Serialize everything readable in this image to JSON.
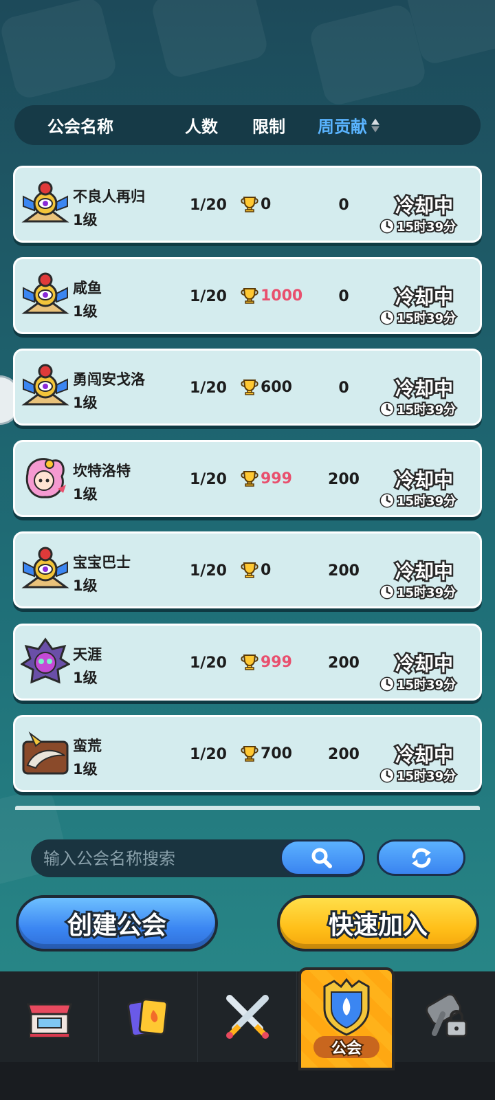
{
  "header": {
    "col_name": "公会名称",
    "col_members": "人数",
    "col_limit": "限制",
    "col_weekly": "周贡献"
  },
  "guilds": [
    {
      "name": "不良人再归",
      "level": "1级",
      "members": "1/20",
      "limit": "0",
      "limit_color": "#1c1c1c",
      "weekly": "0",
      "status": "冷却中",
      "cooldown": "15时39分",
      "emblem": "eye-pyramid-emblem"
    },
    {
      "name": "咸鱼",
      "level": "1级",
      "members": "1/20",
      "limit": "1000",
      "limit_color": "#e8506e",
      "weekly": "0",
      "status": "冷却中",
      "cooldown": "15时39分",
      "emblem": "eye-pyramid-emblem"
    },
    {
      "name": "勇闯安戈洛",
      "level": "1级",
      "members": "1/20",
      "limit": "600",
      "limit_color": "#1c1c1c",
      "weekly": "0",
      "status": "冷却中",
      "cooldown": "15时39分",
      "emblem": "eye-pyramid-emblem"
    },
    {
      "name": "坎特洛特",
      "level": "1级",
      "members": "1/20",
      "limit": "999",
      "limit_color": "#e8506e",
      "weekly": "200",
      "status": "冷却中",
      "cooldown": "15时39分",
      "emblem": "pink-fairy-emblem"
    },
    {
      "name": "宝宝巴士",
      "level": "1级",
      "members": "1/20",
      "limit": "0",
      "limit_color": "#1c1c1c",
      "weekly": "200",
      "status": "冷却中",
      "cooldown": "15时39分",
      "emblem": "eye-pyramid-emblem"
    },
    {
      "name": "天涯",
      "level": "1级",
      "members": "1/20",
      "limit": "999",
      "limit_color": "#e8506e",
      "weekly": "200",
      "status": "冷却中",
      "cooldown": "15时39分",
      "emblem": "purple-demon-emblem"
    },
    {
      "name": "蛮荒",
      "level": "1级",
      "members": "1/20",
      "limit": "700",
      "limit_color": "#1c1c1c",
      "weekly": "200",
      "status": "冷却中",
      "cooldown": "15时39分",
      "emblem": "horn-emblem"
    }
  ],
  "search": {
    "placeholder": "输入公会名称搜索",
    "icon": "search-icon",
    "refresh_icon": "refresh-icon"
  },
  "actions": {
    "create_label": "创建公会",
    "join_label": "快速加入"
  },
  "nav": {
    "items": [
      {
        "icon": "shop-icon"
      },
      {
        "icon": "cards-icon"
      },
      {
        "icon": "battle-swords-icon"
      },
      {
        "icon": "guild-shield-icon",
        "label": "公会",
        "active": true
      },
      {
        "icon": "locked-hammer-icon"
      }
    ],
    "guild_label": "公会"
  },
  "colors": {
    "accent_blue": "#5ab4ff",
    "highlight_pink": "#e8506e",
    "button_blue": "#3b86f2",
    "button_yellow": "#ffbf19"
  }
}
